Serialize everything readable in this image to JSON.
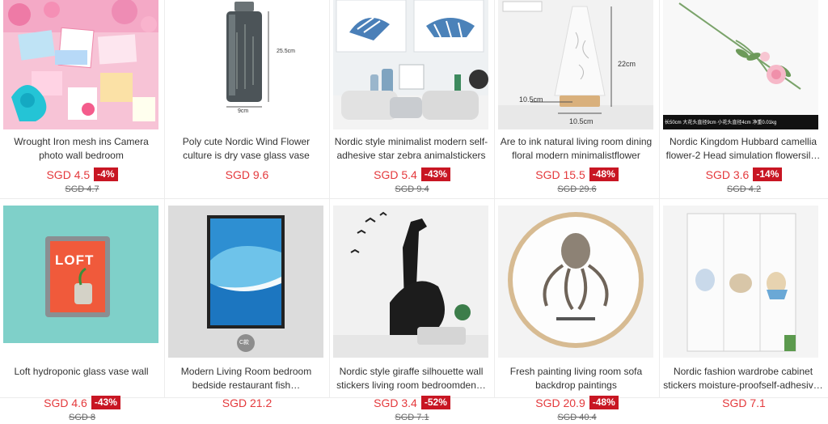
{
  "products": [
    {
      "title": "Wrought Iron mesh ins Camera photo wall bedroom Scandinavianminimali…",
      "price": "SGD 4.5",
      "discount": "-4%",
      "old_price": "SGD 4.7",
      "image": "photo-wall-collage"
    },
    {
      "title": "Poly cute Nordic Wind Flower culture is dry vase glass vase",
      "price": "SGD 9.6",
      "discount": "",
      "old_price": "",
      "image": "glass-vase",
      "image_labels": {
        "height": "25.5cm",
        "width": "9cm"
      }
    },
    {
      "title": "Nordic style minimalist modern self-adhesive star zebra animalstickers",
      "price": "SGD 5.4",
      "discount": "-43%",
      "old_price": "SGD 9.4",
      "image": "zebra-wall-art"
    },
    {
      "title": "Are to ink natural living room dining floral modern minimalistflower",
      "price": "SGD 15.5",
      "discount": "-48%",
      "old_price": "SGD 29.6",
      "image": "ceramic-vase",
      "image_labels": {
        "height": "22cm",
        "top": "10.5cm",
        "bottom": "10.5cm"
      }
    },
    {
      "title": "Nordic Kingdom Hubbard camellia flower-2 Head simulation flowersil…",
      "price": "SGD 3.6",
      "discount": "-14%",
      "old_price": "SGD 4.2",
      "image": "camellia-flower",
      "image_labels": {
        "caption": "长50cm  大花头直径9cm  小花头直径4cm  净重0.01kg"
      }
    },
    {
      "title": "Loft hydroponic glass vase wall",
      "price": "SGD 4.6",
      "discount": "-43%",
      "old_price": "SGD 8",
      "image": "loft-glass-vase",
      "image_labels": {
        "sign": "LOFT"
      }
    },
    {
      "title": "Modern Living Room bedroom bedside restaurant fish…",
      "price": "SGD 21.2",
      "discount": "",
      "old_price": "",
      "image": "fish-painting",
      "image_labels": {
        "badge": "C款"
      }
    },
    {
      "title": "Nordic style giraffe silhouette wall stickers living room bedroomden…",
      "price": "SGD 3.4",
      "discount": "-52%",
      "old_price": "SGD 7.1",
      "image": "giraffe-sticker"
    },
    {
      "title": "Fresh painting living room sofa backdrop paintings DecorativePainting",
      "price": "SGD 20.9",
      "discount": "-48%",
      "old_price": "SGD 40.4",
      "image": "octopus-painting"
    },
    {
      "title": "Nordic fashion wardrobe cabinet stickers moisture-proofself-adhesiv…",
      "price": "SGD 7.1",
      "discount": "",
      "old_price": "",
      "image": "wardrobe-stickers"
    }
  ]
}
